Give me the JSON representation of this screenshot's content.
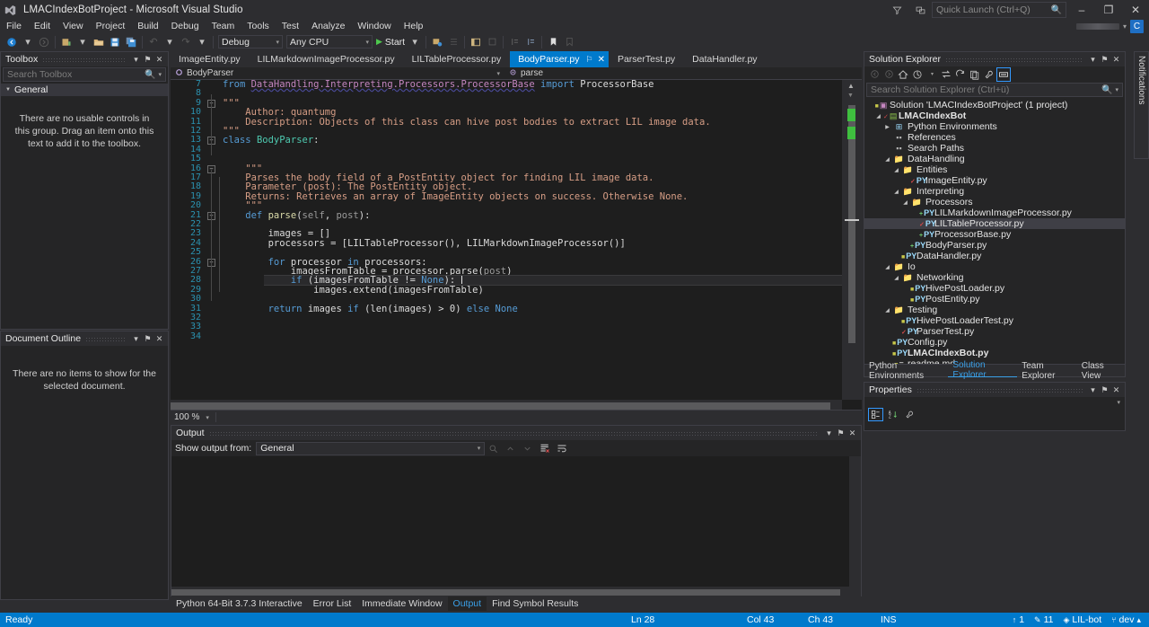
{
  "window": {
    "title": "LMACIndexBotProject - Microsoft Visual Studio",
    "logo_icon": "visual-studio-logo",
    "feedback_icon": "feedback-icon",
    "notify_icon": "quick-actions-icon",
    "minimize": "–",
    "restore": "❐",
    "close": "✕"
  },
  "quick_launch": {
    "placeholder": "Quick Launch (Ctrl+Q)",
    "icon": "search-icon"
  },
  "account": {
    "avatar_initial": "C",
    "caret": "▾"
  },
  "menu": {
    "items": [
      "File",
      "Edit",
      "View",
      "Project",
      "Build",
      "Debug",
      "Team",
      "Tools",
      "Test",
      "Analyze",
      "Window",
      "Help"
    ]
  },
  "toolbar": {
    "nav_back": "◀",
    "nav_forward": "▶",
    "new_project": "▣",
    "open_file": "▱",
    "save": "■",
    "save_all": "▥",
    "undo": "↶",
    "redo": "↷",
    "caret": "▾",
    "config": "Debug",
    "platform": "Any CPU",
    "start_label": "Start",
    "start_glyph": "▶",
    "extra_icons": [
      "attach-process-icon",
      "step-icon",
      "window-layout-icon",
      "comment-icon",
      "indent-icon",
      "outdent-icon",
      "bookmark-icon",
      "bookmark-next-icon"
    ]
  },
  "toolbox": {
    "title": "Toolbox",
    "search_placeholder": "Search Toolbox",
    "group": "General",
    "empty_text": "There are no usable controls in this group. Drag an item onto this text to add it to the toolbox.",
    "dropdown": "▾",
    "pin": "⚑",
    "close": "✕"
  },
  "document_outline": {
    "title": "Document Outline",
    "empty_text": "There are no items to show for the selected document.",
    "dropdown": "▾",
    "pin": "⚑",
    "close": "✕"
  },
  "editor": {
    "tabs": [
      {
        "label": "ImageEntity.py",
        "active": false
      },
      {
        "label": "LILMarkdownImageProcessor.py",
        "active": false
      },
      {
        "label": "LILTableProcessor.py",
        "active": false
      },
      {
        "label": "BodyParser.py",
        "active": true
      },
      {
        "label": "ParserTest.py",
        "active": false
      },
      {
        "label": "DataHandler.py",
        "active": false
      }
    ],
    "active_tab_pin": "⚐",
    "active_tab_close": "✕",
    "nav_class": "BodyParser",
    "nav_class_icon": "class-icon",
    "nav_member": "parse",
    "nav_member_icon": "method-icon",
    "nav_caret": "▾",
    "zoom_level": "100 %",
    "zoom_caret": "▾",
    "lines": [
      {
        "n": 7,
        "indent": 0,
        "tokens": [
          {
            "t": "from ",
            "c": "kw"
          },
          {
            "t": "DataHandling.Interpreting.Processors.ProcessorBase",
            "c": "ns"
          },
          {
            "t": " ",
            "c": "plain"
          },
          {
            "t": "import ",
            "c": "kw"
          },
          {
            "t": "ProcessorBase",
            "c": "plain"
          }
        ]
      },
      {
        "n": 8,
        "indent": 0,
        "tokens": []
      },
      {
        "n": 9,
        "indent": 0,
        "fold": "minus",
        "tokens": [
          {
            "t": "\"\"\"",
            "c": "str"
          }
        ]
      },
      {
        "n": 10,
        "indent": 0,
        "tokens": [
          {
            "t": "    Author: quantumg",
            "c": "str"
          }
        ]
      },
      {
        "n": 11,
        "indent": 0,
        "tokens": [
          {
            "t": "    Description: Objects of this class can hive post bodies to extract LIL image data.",
            "c": "str"
          }
        ]
      },
      {
        "n": 12,
        "indent": 0,
        "tokens": [
          {
            "t": "\"\"\"",
            "c": "str"
          }
        ]
      },
      {
        "n": 13,
        "indent": 0,
        "fold": "minus",
        "tokens": [
          {
            "t": "class ",
            "c": "kw"
          },
          {
            "t": "BodyParser",
            "c": "cls"
          },
          {
            "t": ":",
            "c": "plain"
          }
        ]
      },
      {
        "n": 14,
        "indent": 0,
        "tokens": []
      },
      {
        "n": 15,
        "indent": 0,
        "tokens": []
      },
      {
        "n": 16,
        "indent": 0,
        "fold": "minus",
        "tokens": [
          {
            "t": "    \"\"\"",
            "c": "str"
          }
        ]
      },
      {
        "n": 17,
        "indent": 0,
        "tokens": [
          {
            "t": "    Parses the body field of a PostEntity object for finding LIL image data.",
            "c": "str"
          }
        ]
      },
      {
        "n": 18,
        "indent": 0,
        "tokens": [
          {
            "t": "    Parameter (post): The PostEntity object.",
            "c": "str"
          }
        ]
      },
      {
        "n": 19,
        "indent": 0,
        "tokens": [
          {
            "t": "    Returns: Retrieves an array of ImageEntity objects on success. Otherwise None.",
            "c": "str"
          }
        ]
      },
      {
        "n": 20,
        "indent": 0,
        "tokens": [
          {
            "t": "    \"\"\"",
            "c": "str"
          }
        ]
      },
      {
        "n": 21,
        "indent": 0,
        "fold": "minus",
        "tokens": [
          {
            "t": "    def ",
            "c": "kw"
          },
          {
            "t": "parse",
            "c": "fn"
          },
          {
            "t": "(",
            "c": "plain"
          },
          {
            "t": "self",
            "c": "par"
          },
          {
            "t": ", ",
            "c": "plain"
          },
          {
            "t": "post",
            "c": "par"
          },
          {
            "t": "):",
            "c": "plain"
          }
        ]
      },
      {
        "n": 22,
        "indent": 0,
        "tokens": []
      },
      {
        "n": 23,
        "indent": 0,
        "tokens": [
          {
            "t": "        images = []",
            "c": "plain"
          }
        ]
      },
      {
        "n": 24,
        "indent": 0,
        "tokens": [
          {
            "t": "        processors = [LILTableProcessor(), LILMarkdownImageProcessor()]",
            "c": "plain"
          }
        ]
      },
      {
        "n": 25,
        "indent": 0,
        "tokens": []
      },
      {
        "n": 26,
        "indent": 0,
        "fold": "minus",
        "tokens": [
          {
            "t": "        ",
            "c": "plain"
          },
          {
            "t": "for ",
            "c": "kw"
          },
          {
            "t": "processor ",
            "c": "plain"
          },
          {
            "t": "in ",
            "c": "kw"
          },
          {
            "t": "processors:",
            "c": "plain"
          }
        ]
      },
      {
        "n": 27,
        "indent": 0,
        "tokens": [
          {
            "t": "            imagesFromTable = processor.parse(",
            "c": "plain"
          },
          {
            "t": "post",
            "c": "par"
          },
          {
            "t": ")",
            "c": "plain"
          }
        ]
      },
      {
        "n": 28,
        "indent": 0,
        "highlight": true,
        "caret": true,
        "tokens": [
          {
            "t": "            ",
            "c": "plain"
          },
          {
            "t": "if ",
            "c": "kw"
          },
          {
            "t": "(imagesFromTable != ",
            "c": "plain"
          },
          {
            "t": "None",
            "c": "kw"
          },
          {
            "t": "): ",
            "c": "plain"
          }
        ]
      },
      {
        "n": 29,
        "indent": 0,
        "tokens": [
          {
            "t": "                images.extend(imagesFromTable)",
            "c": "plain"
          }
        ]
      },
      {
        "n": 30,
        "indent": 0,
        "tokens": []
      },
      {
        "n": 31,
        "indent": 0,
        "tokens": [
          {
            "t": "        ",
            "c": "plain"
          },
          {
            "t": "return ",
            "c": "kw"
          },
          {
            "t": "images ",
            "c": "plain"
          },
          {
            "t": "if ",
            "c": "kw"
          },
          {
            "t": "(len(images) > ",
            "c": "plain"
          },
          {
            "t": "0",
            "c": "plain"
          },
          {
            "t": ") ",
            "c": "plain"
          },
          {
            "t": "else ",
            "c": "kw"
          },
          {
            "t": "None",
            "c": "kw"
          }
        ]
      },
      {
        "n": 32,
        "indent": 0,
        "tokens": []
      },
      {
        "n": 33,
        "indent": 0,
        "tokens": []
      },
      {
        "n": 34,
        "indent": 0,
        "tokens": []
      }
    ]
  },
  "output": {
    "title": "Output",
    "show_from_label": "Show output from:",
    "show_from_value": "General",
    "dropdown": "▾",
    "pin": "⚑",
    "close": "✕",
    "icons": [
      "find-message-icon",
      "go-to-previous-icon",
      "go-to-next-icon",
      "clear-all-icon",
      "toggle-word-wrap-icon"
    ],
    "body_text": ""
  },
  "bottom_tabs": [
    {
      "label": "Python 64-Bit 3.7.3 Interactive",
      "active": false
    },
    {
      "label": "Error List",
      "active": false
    },
    {
      "label": "Immediate Window",
      "active": false
    },
    {
      "label": "Output",
      "active": true
    },
    {
      "label": "Find Symbol Results",
      "active": false
    }
  ],
  "solution_explorer": {
    "title": "Solution Explorer",
    "dropdown": "▾",
    "pin": "⚑",
    "close": "✕",
    "search_placeholder": "Search Solution Explorer (Ctrl+ü)",
    "toolbar_icons": [
      "back-icon",
      "forward-icon",
      "home-icon",
      "pending-changes-icon",
      "sync-with-active-document-icon",
      "refresh-icon",
      "collapse-all-icon",
      "show-all-files-icon",
      "properties-icon",
      "preview-selected-items-icon"
    ],
    "tree": [
      {
        "depth": 0,
        "arrow": "none",
        "icon": "solution-icon",
        "icon_class": "ic-sln",
        "git": "lock",
        "label": "Solution 'LMACIndexBotProject' (1 project)",
        "bold": false,
        "selected": false
      },
      {
        "depth": 1,
        "arrow": "open",
        "icon": "python-project-icon",
        "icon_class": "ic-proj",
        "git": "edit",
        "label": "LMACIndexBot",
        "bold": true,
        "selected": false
      },
      {
        "depth": 2,
        "arrow": "closed",
        "icon": "environments-icon",
        "icon_class": "ic-env",
        "git": "",
        "label": "Python Environments",
        "bold": false,
        "selected": false
      },
      {
        "depth": 2,
        "arrow": "none",
        "icon": "references-icon",
        "icon_class": "ic-ref",
        "git": "",
        "label": "References",
        "bold": false,
        "selected": false
      },
      {
        "depth": 2,
        "arrow": "none",
        "icon": "search-paths-icon",
        "icon_class": "ic-ref",
        "git": "",
        "label": "Search Paths",
        "bold": false,
        "selected": false
      },
      {
        "depth": 2,
        "arrow": "open",
        "icon": "folder-icon",
        "icon_class": "ic-folder",
        "git": "",
        "label": "DataHandling",
        "bold": false,
        "selected": false
      },
      {
        "depth": 3,
        "arrow": "open",
        "icon": "folder-icon",
        "icon_class": "ic-folder",
        "git": "",
        "label": "Entities",
        "bold": false,
        "selected": false
      },
      {
        "depth": 4,
        "arrow": "none",
        "icon": "python-file-icon",
        "icon_class": "ic-py",
        "git": "edit",
        "label": "ImageEntity.py",
        "bold": false,
        "selected": false
      },
      {
        "depth": 3,
        "arrow": "open",
        "icon": "folder-icon",
        "icon_class": "ic-folder",
        "git": "",
        "label": "Interpreting",
        "bold": false,
        "selected": false
      },
      {
        "depth": 4,
        "arrow": "open",
        "icon": "folder-icon",
        "icon_class": "ic-folder",
        "git": "",
        "label": "Processors",
        "bold": false,
        "selected": false
      },
      {
        "depth": 5,
        "arrow": "none",
        "icon": "python-file-icon",
        "icon_class": "ic-py",
        "git": "add",
        "label": "LILMarkdownImageProcessor.py",
        "bold": false,
        "selected": false
      },
      {
        "depth": 5,
        "arrow": "none",
        "icon": "python-file-icon",
        "icon_class": "ic-py",
        "git": "edit",
        "label": "LILTableProcessor.py",
        "bold": false,
        "selected": true
      },
      {
        "depth": 5,
        "arrow": "none",
        "icon": "python-file-icon",
        "icon_class": "ic-py",
        "git": "add",
        "label": "ProcessorBase.py",
        "bold": false,
        "selected": false
      },
      {
        "depth": 4,
        "arrow": "none",
        "icon": "python-file-icon",
        "icon_class": "ic-py",
        "git": "add",
        "label": "BodyParser.py",
        "bold": false,
        "selected": false
      },
      {
        "depth": 3,
        "arrow": "none",
        "icon": "python-file-icon",
        "icon_class": "ic-py",
        "git": "lock",
        "label": "DataHandler.py",
        "bold": false,
        "selected": false
      },
      {
        "depth": 2,
        "arrow": "open",
        "icon": "folder-icon",
        "icon_class": "ic-folder",
        "git": "",
        "label": "Io",
        "bold": false,
        "selected": false
      },
      {
        "depth": 3,
        "arrow": "open",
        "icon": "folder-icon",
        "icon_class": "ic-folder",
        "git": "",
        "label": "Networking",
        "bold": false,
        "selected": false
      },
      {
        "depth": 4,
        "arrow": "none",
        "icon": "python-file-icon",
        "icon_class": "ic-py",
        "git": "lock",
        "label": "HivePostLoader.py",
        "bold": false,
        "selected": false
      },
      {
        "depth": 4,
        "arrow": "none",
        "icon": "python-file-icon",
        "icon_class": "ic-py",
        "git": "lock",
        "label": "PostEntity.py",
        "bold": false,
        "selected": false
      },
      {
        "depth": 2,
        "arrow": "open",
        "icon": "folder-icon",
        "icon_class": "ic-folder",
        "git": "",
        "label": "Testing",
        "bold": false,
        "selected": false
      },
      {
        "depth": 3,
        "arrow": "none",
        "icon": "python-file-icon",
        "icon_class": "ic-py",
        "git": "lock",
        "label": "HivePostLoaderTest.py",
        "bold": false,
        "selected": false
      },
      {
        "depth": 3,
        "arrow": "none",
        "icon": "python-file-icon",
        "icon_class": "ic-py",
        "git": "edit",
        "label": "ParserTest.py",
        "bold": false,
        "selected": false
      },
      {
        "depth": 2,
        "arrow": "none",
        "icon": "python-file-icon",
        "icon_class": "ic-py",
        "git": "lock",
        "label": "Config.py",
        "bold": false,
        "selected": false
      },
      {
        "depth": 2,
        "arrow": "none",
        "icon": "python-file-icon",
        "icon_class": "ic-py",
        "git": "lock",
        "label": "LMACIndexBot.py",
        "bold": true,
        "selected": false
      },
      {
        "depth": 2,
        "arrow": "none",
        "icon": "markdown-file-icon",
        "icon_class": "ic-md",
        "git": "lock",
        "label": "readme.md",
        "bold": false,
        "selected": false
      }
    ],
    "tabs": [
      {
        "label": "Python Environments",
        "active": false
      },
      {
        "label": "Solution Explorer",
        "active": true
      },
      {
        "label": "Team Explorer",
        "active": false
      },
      {
        "label": "Class View",
        "active": false
      }
    ]
  },
  "properties": {
    "title": "Properties",
    "dropdown": "▾",
    "pin": "⚑",
    "close": "✕",
    "sub_caret": "▾",
    "icons": [
      "categorized-icon",
      "alphabetical-icon",
      "properties-page-icon"
    ]
  },
  "notifications_tab": {
    "label": "Notifications"
  },
  "status_bar": {
    "ready": "Ready",
    "line": "Ln 28",
    "column": "Col 43",
    "character": "Ch 43",
    "insert_mode": "INS",
    "unpushed_commits": "1",
    "unpushed_icon": "↑",
    "pending_changes": "11",
    "pending_icon": "✎",
    "repository": "LIL-bot",
    "repository_icon": "◈",
    "branch": "dev",
    "branch_icon": "⑂",
    "branch_caret": "▴"
  },
  "colors": {
    "accent": "#007acc",
    "panel": "#252526",
    "chrome": "#2d2d30",
    "editor_bg": "#1e1e1e",
    "border": "#3f3f46"
  }
}
